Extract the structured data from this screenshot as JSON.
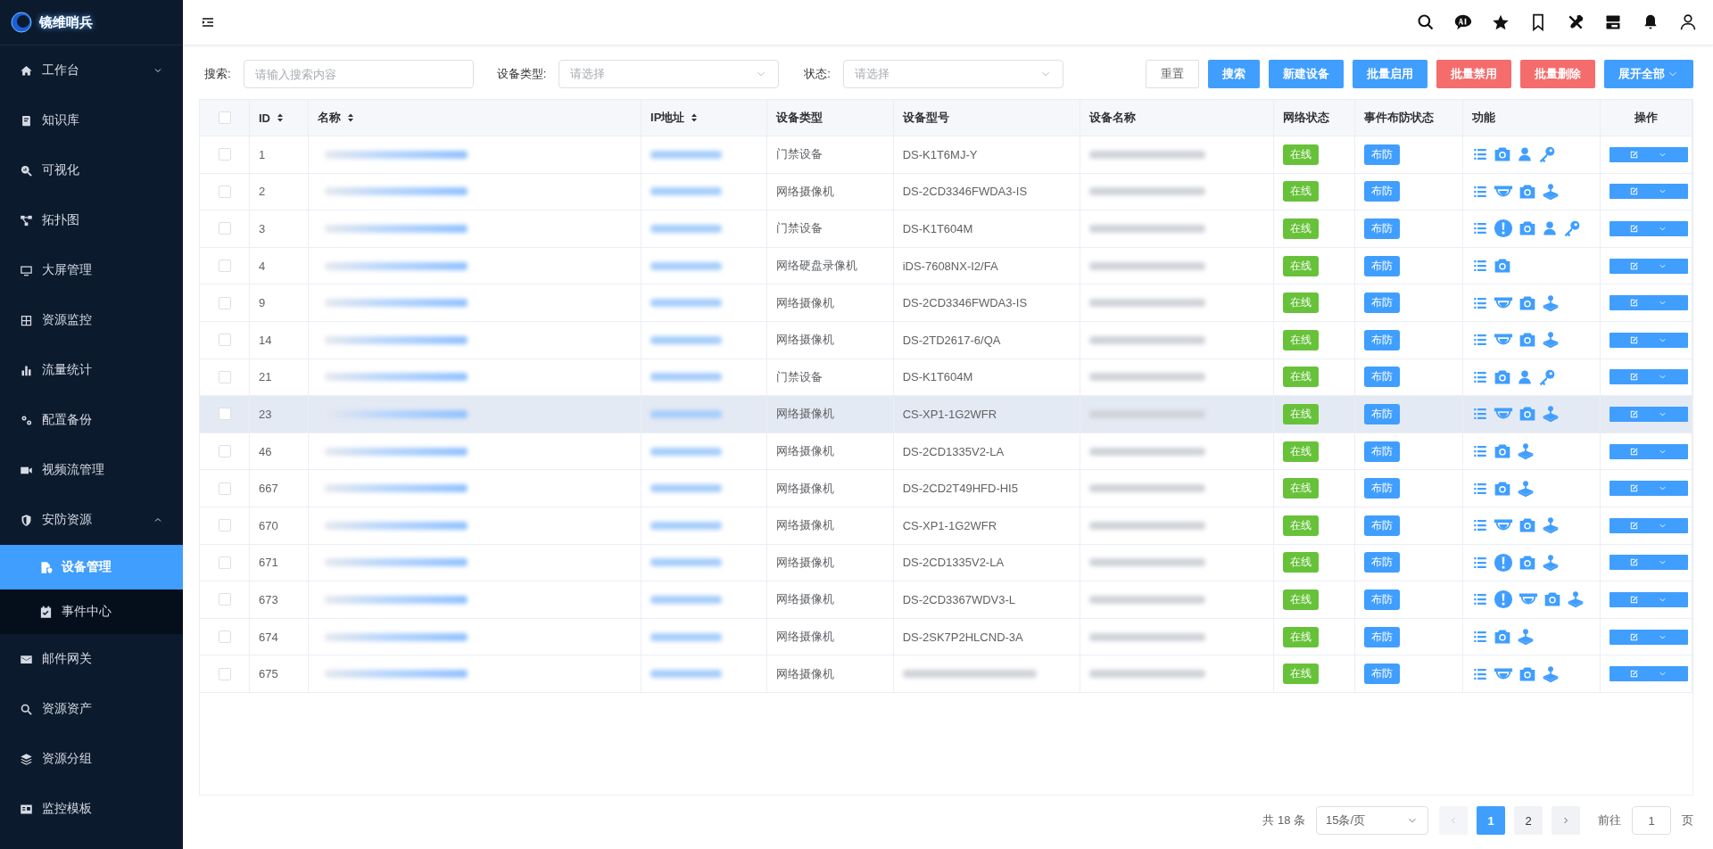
{
  "sidebar": {
    "logo": "镜维哨兵",
    "items": [
      {
        "label": "工作台",
        "selected": false,
        "expanded": false
      },
      {
        "label": "知识库",
        "selected": false
      },
      {
        "label": "可视化",
        "selected": false
      },
      {
        "label": "拓扑图",
        "selected": false
      },
      {
        "label": "大屏管理",
        "selected": false
      },
      {
        "label": "资源监控",
        "selected": false
      },
      {
        "label": "流量统计",
        "selected": false
      },
      {
        "label": "配置备份",
        "selected": false
      },
      {
        "label": "视频流管理",
        "selected": false
      },
      {
        "label": "安防资源",
        "selected": false,
        "expanded": true,
        "children": [
          {
            "label": "设备管理",
            "selected": true
          },
          {
            "label": "事件中心",
            "selected": false
          }
        ]
      },
      {
        "label": "邮件网关",
        "selected": false
      },
      {
        "label": "资源资产",
        "selected": false
      },
      {
        "label": "资源分组",
        "selected": false
      },
      {
        "label": "监控模板",
        "selected": false
      }
    ]
  },
  "filters": [
    {
      "label": "搜索:",
      "placeholder": "请输入搜索内容",
      "kind": "input"
    },
    {
      "label": "设备类型:",
      "placeholder": "请选择",
      "kind": "select"
    },
    {
      "label": "状态:",
      "placeholder": "请选择",
      "kind": "select"
    }
  ],
  "buttons": [
    {
      "label": "重置",
      "kind": "plain"
    },
    {
      "label": "搜索",
      "kind": "primary"
    },
    {
      "label": "新建设备",
      "kind": "primary"
    },
    {
      "label": "批量启用",
      "kind": "primary"
    },
    {
      "label": "批量禁用",
      "kind": "danger"
    },
    {
      "label": "批量删除",
      "kind": "danger"
    },
    {
      "label": "展开全部",
      "kind": "dropdown"
    }
  ],
  "table": {
    "select_all_checked": false,
    "columns": [
      {
        "label": "ID",
        "sortable": true
      },
      {
        "label": "名称",
        "sortable": true
      },
      {
        "label": "IP地址",
        "sortable": true
      },
      {
        "label": "设备类型",
        "sortable": false
      },
      {
        "label": "设备型号",
        "sortable": false
      },
      {
        "label": "设备名称",
        "sortable": false
      },
      {
        "label": "网络状态",
        "sortable": false
      },
      {
        "label": "事件布防状态",
        "sortable": false
      },
      {
        "label": "功能",
        "sortable": false
      },
      {
        "label": "操作",
        "sortable": false
      }
    ],
    "rows": [
      {
        "id": "1",
        "checked": false,
        "hovered": false,
        "type": "门禁设备",
        "model": "DS-K1T6MJ-Y",
        "network_status": "在线",
        "arming_status": "布防",
        "functions": [
          {
            "kind": "list"
          },
          {
            "kind": "camera"
          },
          {
            "kind": "person"
          },
          {
            "kind": "key"
          }
        ]
      },
      {
        "id": "2",
        "checked": false,
        "hovered": false,
        "type": "网络摄像机",
        "model": "DS-2CD3346FWDA3-IS",
        "network_status": "在线",
        "arming_status": "布防",
        "functions": [
          {
            "kind": "list"
          },
          {
            "kind": "dome"
          },
          {
            "kind": "camera"
          },
          {
            "kind": "joystick"
          }
        ]
      },
      {
        "id": "3",
        "checked": false,
        "hovered": false,
        "type": "门禁设备",
        "model": "DS-K1T604M",
        "network_status": "在线",
        "arming_status": "布防",
        "functions": [
          {
            "kind": "list"
          },
          {
            "kind": "alarm"
          },
          {
            "kind": "camera"
          },
          {
            "kind": "person"
          },
          {
            "kind": "key"
          }
        ]
      },
      {
        "id": "4",
        "checked": false,
        "hovered": false,
        "type": "网络硬盘录像机",
        "model": "iDS-7608NX-I2/FA",
        "network_status": "在线",
        "arming_status": "布防",
        "functions": [
          {
            "kind": "list"
          },
          {
            "kind": "camera"
          }
        ]
      },
      {
        "id": "9",
        "checked": false,
        "hovered": false,
        "type": "网络摄像机",
        "model": "DS-2CD3346FWDA3-IS",
        "network_status": "在线",
        "arming_status": "布防",
        "functions": [
          {
            "kind": "list"
          },
          {
            "kind": "dome"
          },
          {
            "kind": "camera"
          },
          {
            "kind": "joystick"
          }
        ]
      },
      {
        "id": "14",
        "checked": false,
        "hovered": false,
        "type": "网络摄像机",
        "model": "DS-2TD2617-6/QA",
        "network_status": "在线",
        "arming_status": "布防",
        "functions": [
          {
            "kind": "list"
          },
          {
            "kind": "dome"
          },
          {
            "kind": "camera"
          },
          {
            "kind": "joystick"
          }
        ]
      },
      {
        "id": "21",
        "checked": false,
        "hovered": false,
        "type": "门禁设备",
        "model": "DS-K1T604M",
        "network_status": "在线",
        "arming_status": "布防",
        "functions": [
          {
            "kind": "list"
          },
          {
            "kind": "camera"
          },
          {
            "kind": "person"
          },
          {
            "kind": "key"
          }
        ]
      },
      {
        "id": "23",
        "checked": false,
        "hovered": true,
        "type": "网络摄像机",
        "model": "CS-XP1-1G2WFR",
        "network_status": "在线",
        "arming_status": "布防",
        "functions": [
          {
            "kind": "list"
          },
          {
            "kind": "dome"
          },
          {
            "kind": "camera"
          },
          {
            "kind": "joystick"
          }
        ]
      },
      {
        "id": "46",
        "checked": false,
        "hovered": false,
        "type": "网络摄像机",
        "model": "DS-2CD1335V2-LA",
        "network_status": "在线",
        "arming_status": "布防",
        "functions": [
          {
            "kind": "list"
          },
          {
            "kind": "camera"
          },
          {
            "kind": "joystick"
          }
        ]
      },
      {
        "id": "667",
        "checked": false,
        "hovered": false,
        "type": "网络摄像机",
        "model": "DS-2CD2T49HFD-HI5",
        "network_status": "在线",
        "arming_status": "布防",
        "functions": [
          {
            "kind": "list"
          },
          {
            "kind": "camera"
          },
          {
            "kind": "joystick"
          }
        ]
      },
      {
        "id": "670",
        "checked": false,
        "hovered": false,
        "type": "网络摄像机",
        "model": "CS-XP1-1G2WFR",
        "network_status": "在线",
        "arming_status": "布防",
        "functions": [
          {
            "kind": "list"
          },
          {
            "kind": "dome"
          },
          {
            "kind": "camera"
          },
          {
            "kind": "joystick"
          }
        ]
      },
      {
        "id": "671",
        "checked": false,
        "hovered": false,
        "type": "网络摄像机",
        "model": "DS-2CD1335V2-LA",
        "network_status": "在线",
        "arming_status": "布防",
        "functions": [
          {
            "kind": "list"
          },
          {
            "kind": "alarm"
          },
          {
            "kind": "camera"
          },
          {
            "kind": "joystick"
          }
        ]
      },
      {
        "id": "673",
        "checked": false,
        "hovered": false,
        "type": "网络摄像机",
        "model": "DS-2CD3367WDV3-L",
        "network_status": "在线",
        "arming_status": "布防",
        "functions": [
          {
            "kind": "list"
          },
          {
            "kind": "alarm"
          },
          {
            "kind": "dome"
          },
          {
            "kind": "camera"
          },
          {
            "kind": "joystick"
          }
        ]
      },
      {
        "id": "674",
        "checked": false,
        "hovered": false,
        "type": "网络摄像机",
        "model": "DS-2SK7P2HLCND-3A",
        "network_status": "在线",
        "arming_status": "布防",
        "functions": [
          {
            "kind": "list"
          },
          {
            "kind": "camera"
          },
          {
            "kind": "joystick"
          }
        ]
      },
      {
        "id": "675",
        "checked": false,
        "hovered": false,
        "type": "网络摄像机",
        "network_status": "在线",
        "arming_status": "布防",
        "functions": [
          {
            "kind": "list"
          },
          {
            "kind": "dome"
          },
          {
            "kind": "camera"
          },
          {
            "kind": "joystick"
          }
        ]
      }
    ]
  },
  "pagination": {
    "total": "共 18 条",
    "page_size": "15条/页",
    "prev_disabled": true,
    "next_disabled": false,
    "pages": [
      {
        "label": "1",
        "selected": true
      },
      {
        "label": "2",
        "selected": false
      }
    ],
    "goto_label": "前往",
    "goto_value": "1",
    "goto_suffix": "页"
  }
}
